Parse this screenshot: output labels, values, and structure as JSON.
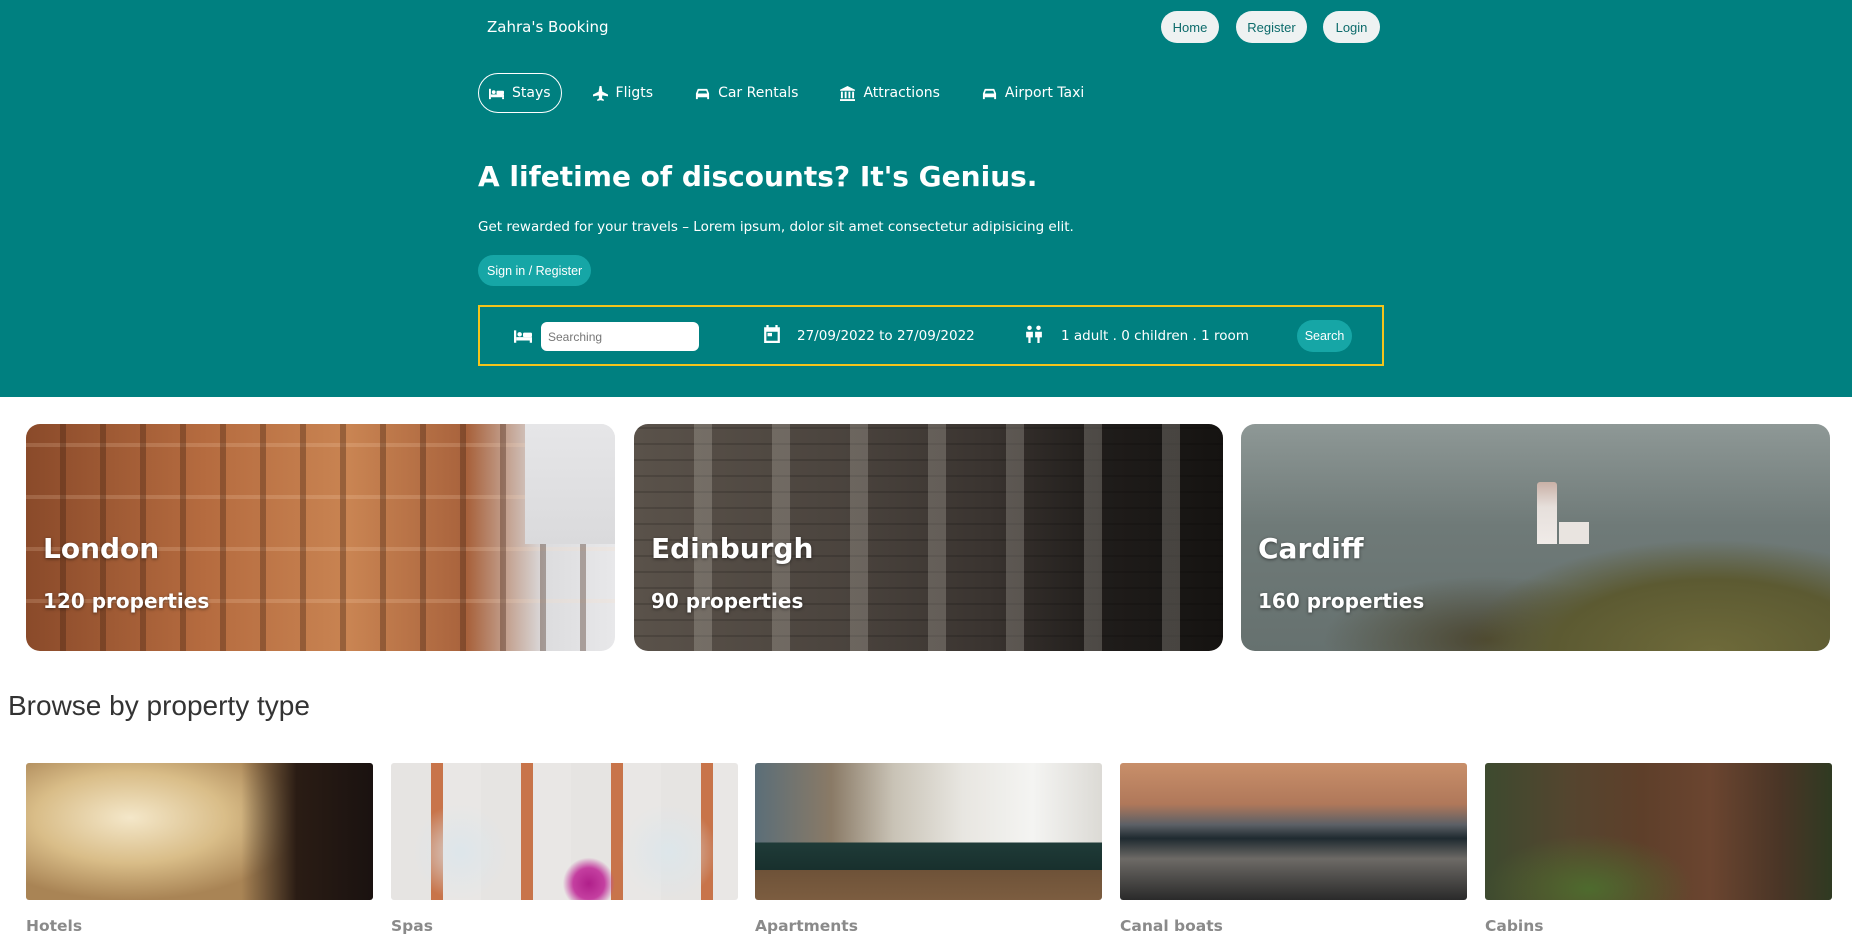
{
  "header": {
    "brand": "Zahra's Booking",
    "buttons": {
      "home": "Home",
      "register": "Register",
      "login": "Login"
    },
    "nav": [
      {
        "label": "Stays",
        "icon": "bed-icon",
        "active": true
      },
      {
        "label": "Fligts",
        "icon": "plane-icon",
        "active": false
      },
      {
        "label": "Car Rentals",
        "icon": "car-icon",
        "active": false
      },
      {
        "label": "Attractions",
        "icon": "landmark-icon",
        "active": false
      },
      {
        "label": "Airport Taxi",
        "icon": "taxi-icon",
        "active": false
      }
    ],
    "hero": {
      "title": "A lifetime of discounts? It's Genius.",
      "subtitle": "Get rewarded for your travels – Lorem ipsum, dolor sit amet consectetur adipisicing elit.",
      "signin_label": "Sign in / Register"
    },
    "search": {
      "placeholder": "Searching",
      "dates": "27/09/2022 to 27/09/2022",
      "guests": "1 adult . 0 children . 1 room",
      "button": "Search"
    }
  },
  "cities": [
    {
      "name": "London",
      "count": "120 properties"
    },
    {
      "name": "Edinburgh",
      "count": "90 properties"
    },
    {
      "name": "Cardiff",
      "count": "160 properties"
    }
  ],
  "browse": {
    "title": "Browse by property type",
    "types": [
      {
        "label": "Hotels"
      },
      {
        "label": "Spas"
      },
      {
        "label": "Apartments"
      },
      {
        "label": "Canal boats"
      },
      {
        "label": "Cabins"
      }
    ]
  },
  "colors": {
    "primary": "#008080",
    "accent_border": "#f3c41b",
    "button": "#16a6a6"
  }
}
